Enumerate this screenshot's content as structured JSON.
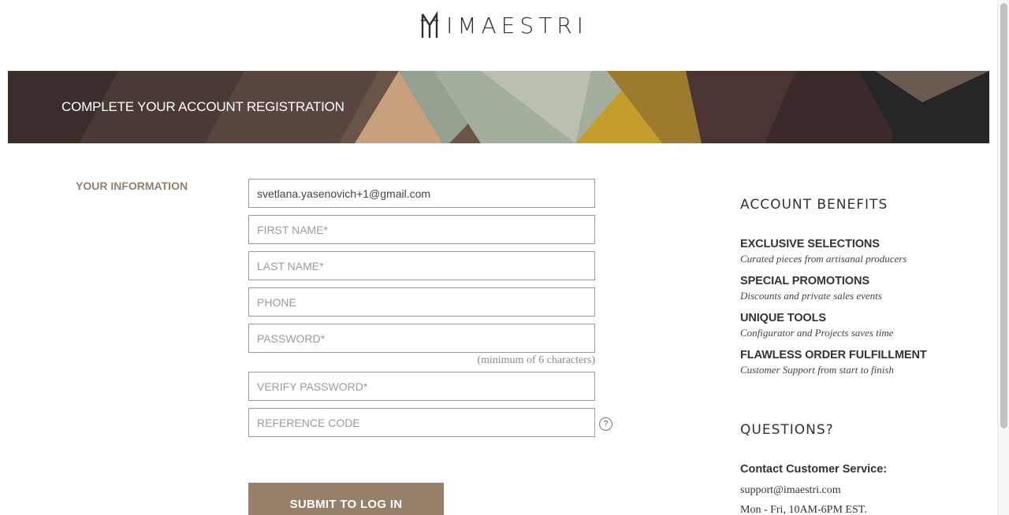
{
  "header": {
    "logo_text": "IMAESTRI"
  },
  "banner": {
    "title": "COMPLETE YOUR ACCOUNT REGISTRATION"
  },
  "form": {
    "section_label": "YOUR INFORMATION",
    "email": {
      "value": "svetlana.yasenovich+1@gmail.com",
      "placeholder": ""
    },
    "first_name": {
      "value": "",
      "placeholder": "FIRST NAME*"
    },
    "last_name": {
      "value": "",
      "placeholder": "LAST NAME*"
    },
    "phone": {
      "value": "",
      "placeholder": "PHONE"
    },
    "password": {
      "value": "",
      "placeholder": "PASSWORD*"
    },
    "password_hint": "(minimum of 6 characters)",
    "verify_password": {
      "value": "",
      "placeholder": "VERIFY PASSWORD*"
    },
    "reference_code": {
      "value": "",
      "placeholder": "REFERENCE CODE"
    },
    "help_icon_glyph": "?",
    "submit_label": "SUBMIT TO LOG IN"
  },
  "benefits": {
    "title": "ACCOUNT BENEFITS",
    "items": [
      {
        "heading": "EXCLUSIVE SELECTIONS",
        "description": "Curated pieces from artisanal producers"
      },
      {
        "heading": "SPECIAL PROMOTIONS",
        "description": "Discounts and private sales events"
      },
      {
        "heading": "UNIQUE TOOLS",
        "description": "Configurator and Projects saves time"
      },
      {
        "heading": "FLAWLESS ORDER FULFILLMENT",
        "description": "Customer Support from start to finish"
      }
    ]
  },
  "questions": {
    "title": "QUESTIONS?",
    "contact_heading": "Contact Customer Service:",
    "email": "support@imaestri.com",
    "hours": "Mon - Fri, 10AM-6PM EST."
  },
  "colors": {
    "accent": "#978069",
    "label": "#94806a",
    "banner_dark": "#2a2322"
  }
}
